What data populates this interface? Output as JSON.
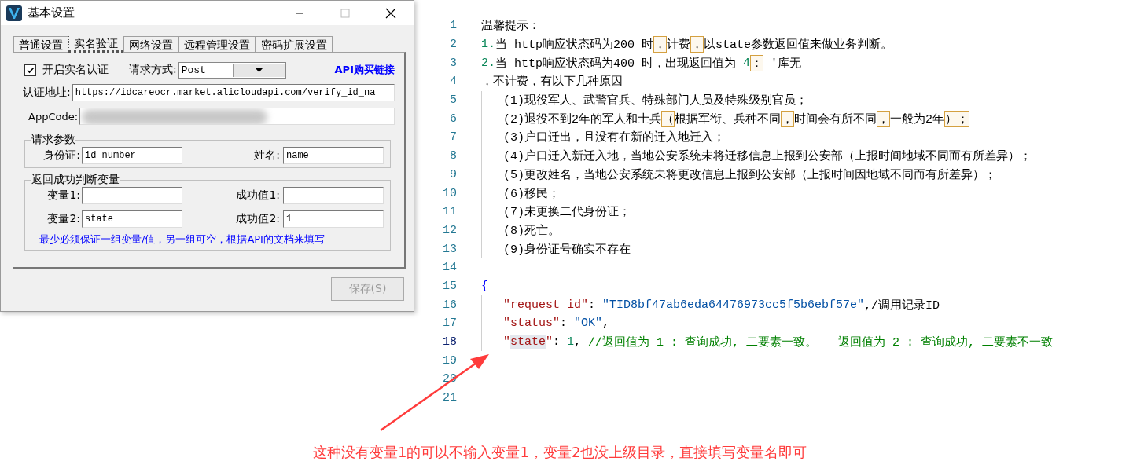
{
  "dialog": {
    "title": "基本设置",
    "tabs": [
      {
        "label": "普通设置",
        "selected": false
      },
      {
        "label": "实名验证",
        "selected": true
      },
      {
        "label": "网络设置",
        "selected": false
      },
      {
        "label": "远程管理设置",
        "selected": false
      },
      {
        "label": "密码扩展设置",
        "selected": false
      }
    ],
    "enable_checkbox": {
      "label": "开启实名认证",
      "checked": true
    },
    "request_method": {
      "label": "请求方式:",
      "value": "Post"
    },
    "buy_link": "API购买链接",
    "auth_url": {
      "label": "认证地址:",
      "value": "https://idcareocr.market.alicloudapi.com/verify_id_na"
    },
    "app_code": {
      "label": "AppCode:",
      "redacted": true
    },
    "request_params": {
      "title": "请求参数",
      "fields": [
        {
          "label": "身份证:",
          "value": "id_number"
        },
        {
          "label": "姓名:",
          "value": "name"
        }
      ]
    },
    "success_check": {
      "title": "返回成功判断变量",
      "fields": [
        {
          "label": "变量1:"
        },
        {
          "label": "成功值1:"
        },
        {
          "label": "变量2:",
          "value": "state"
        },
        {
          "label": "成功值2:",
          "value": "1"
        }
      ],
      "note": "最少必须保证一组变量/值，另一组可空，根据API的文档来填写"
    },
    "save_button": {
      "label": "保存(S)",
      "disabled": true
    }
  },
  "editor": {
    "lines": [
      {
        "number": "1",
        "current": false,
        "indented": false,
        "segments": [
          {
            "kind": "plain",
            "text": "温馨提示："
          }
        ]
      },
      {
        "number": "2",
        "current": false,
        "indented": false,
        "segments": [
          {
            "kind": "num",
            "text": "1."
          },
          {
            "kind": "plain",
            "text": "当 http响应状态码为200 时"
          },
          {
            "kind": "boxed",
            "text": "，"
          },
          {
            "kind": "plain",
            "text": "计费"
          },
          {
            "kind": "boxed",
            "text": "，"
          },
          {
            "kind": "plain",
            "text": "以state参数返回值来做业务判断。"
          }
        ]
      },
      {
        "number": "3",
        "current": false,
        "indented": false,
        "segments": [
          {
            "kind": "num",
            "text": "2."
          },
          {
            "kind": "plain",
            "text": "当 http响应状态码为400 时，出现返回值为 "
          },
          {
            "kind": "num",
            "text": "4"
          },
          {
            "kind": "boxed",
            "text": "："
          },
          {
            "kind": "plain",
            "text": " '库无"
          }
        ]
      },
      {
        "number": "4",
        "current": false,
        "indented": false,
        "segments": [
          {
            "kind": "plain",
            "text": "，不计费，有以下几种原因"
          }
        ]
      },
      {
        "number": "5",
        "current": false,
        "indented": true,
        "segments": [
          {
            "kind": "plain",
            "text": "(1)现役军人、武警官兵、特殊部门人员及特殊级别官员；"
          }
        ]
      },
      {
        "number": "6",
        "current": false,
        "indented": true,
        "segments": [
          {
            "kind": "plain",
            "text": "(2)退役不到2年的军人和士兵"
          },
          {
            "kind": "boxed",
            "text": "（"
          },
          {
            "kind": "plain",
            "text": "根据军衔、兵种不同"
          },
          {
            "kind": "boxed",
            "text": "，"
          },
          {
            "kind": "plain",
            "text": "时间会有所不同"
          },
          {
            "kind": "boxed",
            "text": "，"
          },
          {
            "kind": "plain",
            "text": "一般为2年"
          },
          {
            "kind": "boxed",
            "text": "）；"
          }
        ]
      },
      {
        "number": "7",
        "current": false,
        "indented": true,
        "segments": [
          {
            "kind": "plain",
            "text": "(3)户口迁出，且没有在新的迁入地迁入；"
          }
        ]
      },
      {
        "number": "8",
        "current": false,
        "indented": true,
        "segments": [
          {
            "kind": "plain",
            "text": "(4)户口迁入新迁入地，当地公安系统未将迁移信息上报到公安部（上报时间地域不同而有所差异）；"
          }
        ]
      },
      {
        "number": "9",
        "current": false,
        "indented": true,
        "segments": [
          {
            "kind": "plain",
            "text": "(5)更改姓名，当地公安系统未将更改信息上报到公安部（上报时间因地域不同而有所差异）；"
          }
        ]
      },
      {
        "number": "10",
        "current": false,
        "indented": true,
        "segments": [
          {
            "kind": "plain",
            "text": "(6)移民；"
          }
        ]
      },
      {
        "number": "11",
        "current": false,
        "indented": true,
        "segments": [
          {
            "kind": "plain",
            "text": "(7)未更换二代身份证；"
          }
        ]
      },
      {
        "number": "12",
        "current": false,
        "indented": true,
        "segments": [
          {
            "kind": "plain",
            "text": "(8)死亡。"
          }
        ]
      },
      {
        "number": "13",
        "current": false,
        "indented": true,
        "segments": [
          {
            "kind": "plain",
            "text": "(9)身份证号确实不存在"
          }
        ]
      },
      {
        "number": "14",
        "current": false
      },
      {
        "number": "15",
        "current": false,
        "indented": false,
        "segments": [
          {
            "kind": "brace",
            "text": "{"
          }
        ]
      },
      {
        "number": "16",
        "current": false,
        "indented": true,
        "segments": [
          {
            "kind": "key",
            "text": "\"request_id\""
          },
          {
            "kind": "plain",
            "text": ": "
          },
          {
            "kind": "str",
            "text": "\"TID8bf47ab6eda64476973cc5f5b6ebf57e\""
          },
          {
            "kind": "plain",
            "text": ",/调用记录ID"
          }
        ]
      },
      {
        "number": "17",
        "current": false,
        "indented": true,
        "segments": [
          {
            "kind": "key",
            "text": "\"status\""
          },
          {
            "kind": "plain",
            "text": ": "
          },
          {
            "kind": "str",
            "text": "\"OK\""
          },
          {
            "kind": "plain",
            "text": ","
          }
        ]
      },
      {
        "number": "18",
        "current": true,
        "indented": true,
        "segments": [
          {
            "kind": "key",
            "text": "\""
          },
          {
            "kind": "key-highlight",
            "text": "state"
          },
          {
            "kind": "key",
            "text": "\""
          },
          {
            "kind": "plain",
            "text": ": "
          },
          {
            "kind": "num",
            "text": "1"
          },
          {
            "kind": "plain",
            "text": ", "
          },
          {
            "kind": "comment",
            "text": "//返回值为 1 : 查询成功, 二要素一致。   返回值为 2 : 查询成功, 二要素不一致"
          }
        ]
      },
      {
        "number": "19",
        "current": false
      },
      {
        "number": "20",
        "current": false
      },
      {
        "number": "21",
        "current": false
      }
    ]
  },
  "annotation": {
    "text": "这种没有变量1的可以不输入变量1，变量2也没上级目录，直接填写变量名即可"
  }
}
